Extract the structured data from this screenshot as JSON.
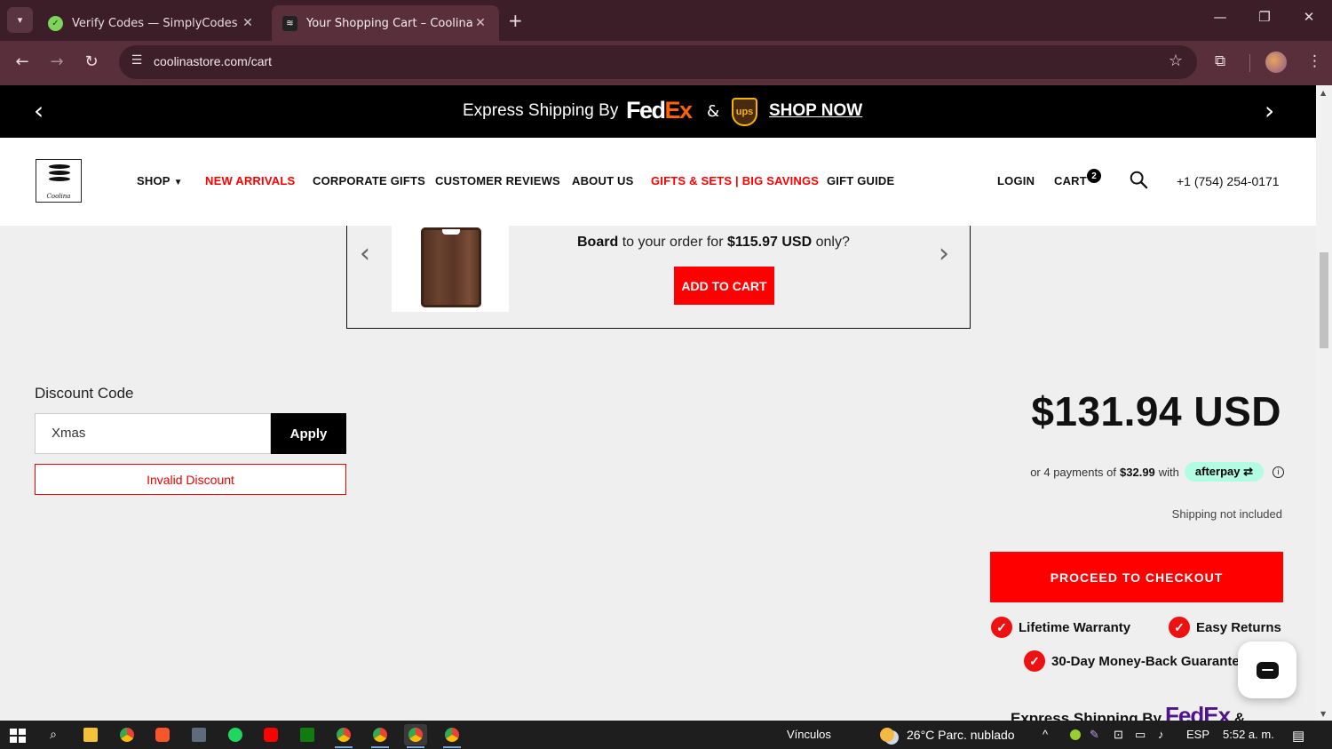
{
  "browser": {
    "tabs": [
      {
        "title": "Verify Codes — SimplyCodes",
        "active": false
      },
      {
        "title": "Your Shopping Cart – Coolina",
        "active": true
      }
    ],
    "new_tab": "+",
    "url": "coolinastore.com/cart",
    "window_controls": {
      "minimize": "—",
      "restore": "❐",
      "close": "✕"
    }
  },
  "promo_bar": {
    "text": "Express Shipping By",
    "fedex_fed": "Fed",
    "fedex_ex": "Ex",
    "amp": "&",
    "ups": "ups",
    "cta": "SHOP NOW",
    "prev": "‹",
    "next": "›"
  },
  "header": {
    "logo_text": "Coolina",
    "nav": [
      {
        "label": "SHOP",
        "color": "#111111"
      },
      {
        "label": "NEW ARRIVALS",
        "color": "#ff0000"
      },
      {
        "label": "CORPORATE GIFTS",
        "color": "#111111"
      },
      {
        "label": "CUSTOMER REVIEWS",
        "color": "#111111"
      },
      {
        "label": "ABOUT US",
        "color": "#111111"
      },
      {
        "label": "GIFTS & SETS | BIG SAVINGS",
        "color": "#ff0000"
      },
      {
        "label": "GIFT GUIDE",
        "color": "#111111"
      }
    ],
    "login": "LOGIN",
    "cart": "CART",
    "cart_count": "2",
    "phone": "+1 (754) 254-0171"
  },
  "upsell": {
    "product_name": "Board",
    "text_middle": "to your order for",
    "price": "$115.97 USD",
    "text_end": "only?",
    "button": "ADD TO CART",
    "prev": "‹",
    "next": "›"
  },
  "discount": {
    "label": "Discount Code",
    "value": "Xmas",
    "apply": "Apply",
    "error": "Invalid Discount"
  },
  "summary": {
    "total": "$131.94 USD",
    "afterpay_prefix": "or 4 payments of",
    "afterpay_amount": "$32.99",
    "afterpay_with": "with",
    "afterpay_brand": "afterpay",
    "shipping_note": "Shipping not included",
    "checkout": "PROCEED TO CHECKOUT",
    "badges": [
      "Lifetime Warranty",
      "Easy Returns",
      "30-Day Money-Back Guarantee"
    ],
    "footer_text": "Express Shipping By",
    "footer_fedex": "FedEx",
    "footer_amp": "&"
  },
  "taskbar": {
    "links": "Vínculos",
    "weather": "26°C  Parc. nublado",
    "language": "ESP",
    "time": "5:52 a. m."
  },
  "colors": {
    "brand_red": "#ff0000",
    "chrome_tab_bar": "#3b1e28",
    "chrome_toolbar": "#5a2f3c",
    "afterpay_mint": "#b2fce4"
  }
}
